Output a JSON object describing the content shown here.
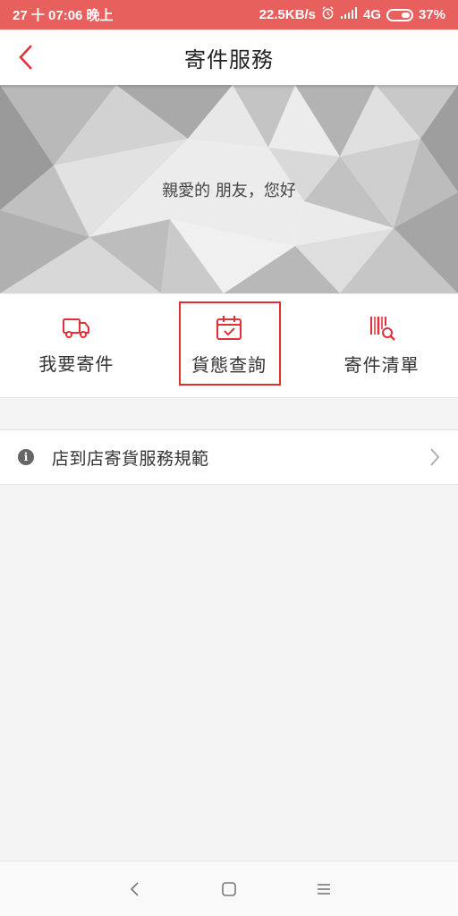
{
  "status_bar": {
    "left_text": "27 十 07:06 晚上",
    "speed": "22.5KB/s",
    "network": "4G",
    "battery": "37%"
  },
  "header": {
    "title": "寄件服務"
  },
  "banner": {
    "greeting": "親愛的 朋友，您好"
  },
  "actions": [
    {
      "label": "我要寄件",
      "icon": "truck-icon"
    },
    {
      "label": "貨態查詢",
      "icon": "calendar-check-icon"
    },
    {
      "label": "寄件清單",
      "icon": "barcode-search-icon"
    }
  ],
  "rules_row": {
    "label": "店到店寄貨服務規範",
    "icon": "info-icon"
  },
  "colors": {
    "status_bar": "#e8605e",
    "accent": "#e0303a"
  }
}
